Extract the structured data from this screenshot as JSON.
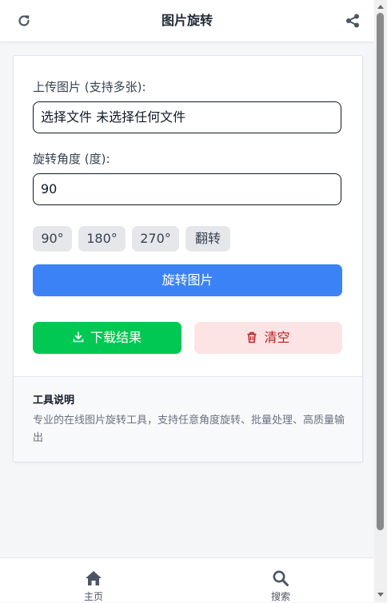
{
  "header": {
    "title": "图片旋转",
    "left_icon": "refresh-icon",
    "right_icon": "share-icon"
  },
  "form": {
    "upload_label": "上传图片 (支持多张):",
    "file_input_text": "选择文件 未选择任何文件",
    "angle_label": "旋转角度 (度):",
    "angle_value": "90",
    "presets": [
      "90°",
      "180°",
      "270°",
      "翻转"
    ],
    "rotate_button": "旋转图片",
    "download_button": "下载结果",
    "clear_button": "清空"
  },
  "info": {
    "title": "工具说明",
    "text": "专业的在线图片旋转工具，支持任意角度旋转、批量处理、高质量输出"
  },
  "bottom_nav": {
    "items": [
      {
        "label": "主页",
        "icon": "home-icon"
      },
      {
        "label": "搜索",
        "icon": "search-icon"
      }
    ]
  },
  "colors": {
    "primary": "#3b82f6",
    "success": "#00c853",
    "danger_bg": "#fde4e4",
    "danger_text": "#b91c1c"
  }
}
